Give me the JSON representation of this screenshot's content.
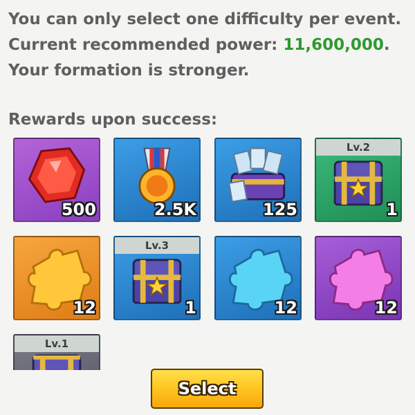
{
  "info": {
    "line1": "You can only select one difficulty per event.",
    "line2_prefix": "Current recommended power: ",
    "line2_power": "11,600,000",
    "line2_suffix": ".",
    "line3": "Your formation is stronger."
  },
  "rewards": {
    "title": "Rewards upon success:",
    "items": [
      {
        "name": "red-gem",
        "count": "500",
        "level": ""
      },
      {
        "name": "medal",
        "count": "2.5K",
        "level": ""
      },
      {
        "name": "ticket-chest",
        "count": "125",
        "level": ""
      },
      {
        "name": "chest",
        "count": "1",
        "level": "Lv.2"
      },
      {
        "name": "orange-puzzle-piece",
        "count": "12",
        "level": ""
      },
      {
        "name": "chest",
        "count": "1",
        "level": "Lv.3"
      },
      {
        "name": "blue-puzzle-piece",
        "count": "12",
        "level": ""
      },
      {
        "name": "pink-puzzle-piece",
        "count": "12",
        "level": ""
      },
      {
        "name": "chest",
        "count": "",
        "level": "Lv.1"
      }
    ]
  },
  "colors": {
    "power_value": "#2f9a2f",
    "text": "#5f5f5f",
    "button": "#ffc21c"
  },
  "actions": {
    "select_label": "Select"
  }
}
